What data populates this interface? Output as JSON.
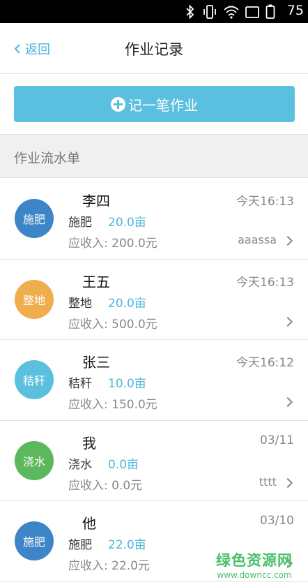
{
  "status_bar": {
    "battery_level": "75"
  },
  "nav": {
    "back_label": "返回",
    "title": "作业记录"
  },
  "add_button": {
    "label": "记一笔作业"
  },
  "section": {
    "title": "作业流水单"
  },
  "colors": {
    "accent": "#4db6dc",
    "button": "#5bbfe0",
    "fertilize": "#3d85c6",
    "tillage": "#f0ad4e",
    "straw": "#5bc0de",
    "irrigate": "#5cb85c"
  },
  "records": [
    {
      "badge": "施肥",
      "name": "李四",
      "time": "今天16:13",
      "type": "施肥",
      "area": "20.0亩",
      "income": "应收入: 200.0元",
      "note": "aaassa"
    },
    {
      "badge": "整地",
      "name": "王五",
      "time": "今天16:13",
      "type": "整地",
      "area": "20.0亩",
      "income": "应收入: 500.0元",
      "note": ""
    },
    {
      "badge": "秸秆",
      "name": "张三",
      "time": "今天16:12",
      "type": "秸秆",
      "area": "10.0亩",
      "income": "应收入: 150.0元",
      "note": ""
    },
    {
      "badge": "浇水",
      "name": "我",
      "time": "03/11",
      "type": "浇水",
      "area": "0.0亩",
      "income": "应收入: 0.0元",
      "note": "tttt"
    },
    {
      "badge": "施肥",
      "name": "他",
      "time": "03/10",
      "type": "施肥",
      "area": "22.0亩",
      "income": "应收入: 22.0元",
      "note": ""
    }
  ],
  "watermark": {
    "title": "绿色资源网",
    "url": "www.downcc.com"
  }
}
